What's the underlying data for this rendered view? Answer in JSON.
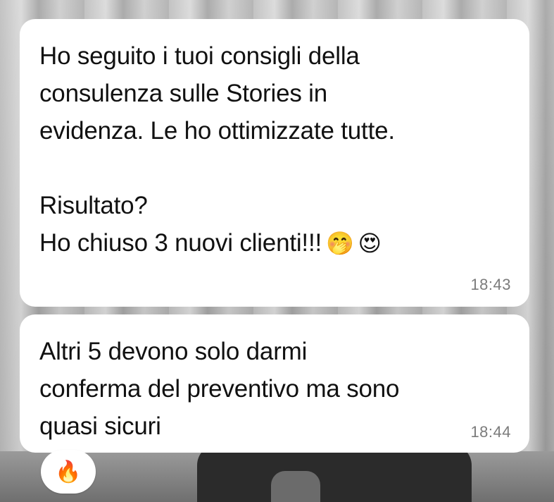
{
  "messages": [
    {
      "lines": [
        "Ho seguito i tuoi consigli della",
        "consulenza sulle Stories in",
        "evidenza. Le ho ottimizzate tutte.",
        "",
        "Risultato?",
        "Ho chiuso 3 nuovi clienti!!!"
      ],
      "emojis": [
        "🤭",
        "😍"
      ],
      "time": "18:43"
    },
    {
      "lines": [
        "Altri 5 devono solo darmi",
        "conferma del preventivo ma sono",
        "quasi sicuri"
      ],
      "time": "18:44"
    }
  ],
  "reaction": {
    "emoji": "🔥",
    "icon": "fire-icon"
  }
}
